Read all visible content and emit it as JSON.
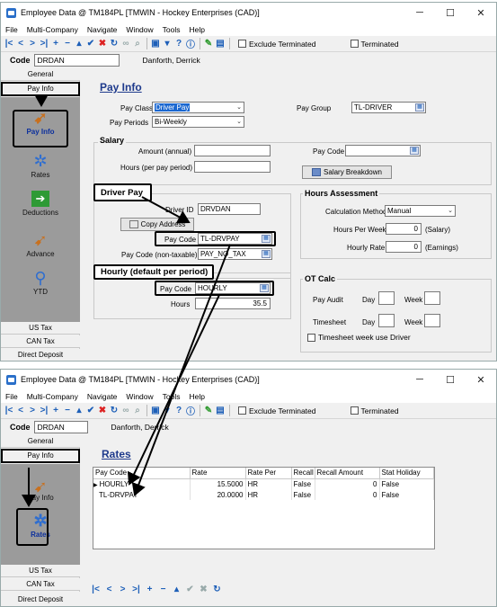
{
  "window": {
    "title": "Employee Data @ TM184PL [TMWIN - Hockey Enterprises (CAD)]",
    "controls": [
      "─",
      "☐",
      "✕"
    ]
  },
  "menu": [
    "File",
    "Multi-Company",
    "Navigate",
    "Window",
    "Tools",
    "Help"
  ],
  "toolbar": {
    "exclude_terminated": "Exclude Terminated",
    "terminated": "Terminated"
  },
  "code_bar": {
    "label": "Code",
    "value": "DRDAN",
    "name": "Danforth, Derrick"
  },
  "sidebar": {
    "tabs": [
      "General",
      "Pay Info"
    ],
    "bottom_tabs": [
      "US Tax",
      "CAN Tax",
      "Direct Deposit"
    ],
    "icons": [
      "Pay Info",
      "Rates",
      "Deductions",
      "Advance",
      "YTD"
    ]
  },
  "pay_info": {
    "title": "Pay Info",
    "pay_class_label": "Pay Class",
    "pay_class_value": "Driver Pay",
    "pay_periods_label": "Pay Periods",
    "pay_periods_value": "Bi-Weekly",
    "pay_group_label": "Pay Group",
    "pay_group_value": "TL-DRIVER",
    "salary": {
      "title": "Salary",
      "amount_label": "Amount  (annual)",
      "hours_label": "Hours (per pay period)",
      "pay_code_label": "Pay Code",
      "breakdown_button": "Salary Breakdown"
    },
    "driver_pay": {
      "title": "Driver Pay",
      "driver_id_label": "Driver ID",
      "driver_id_value": "DRVDAN",
      "copy_address": "Copy Address",
      "pay_code_label": "Pay Code",
      "pay_code_value": "TL-DRVPAY",
      "pay_code_nt_label": "Pay Code (non-taxable)",
      "pay_code_nt_value": "PAY_NO_TAX"
    },
    "hourly": {
      "title": "Hourly (default per period)",
      "pay_code_label": "Pay Code",
      "pay_code_value": "HOURLY",
      "hours_label": "Hours",
      "hours_value": "35.5"
    },
    "hours_assessment": {
      "title": "Hours Assessment",
      "calc_method_label": "Calculation Method",
      "calc_method_value": "Manual",
      "hours_per_week_label": "Hours Per Week",
      "hours_per_week_value": "0",
      "hours_per_week_unit": "(Salary)",
      "hourly_rate_label": "Hourly Rate",
      "hourly_rate_value": "0",
      "hourly_rate_unit": "(Earnings)"
    },
    "ot_calc": {
      "title": "OT Calc",
      "pay_audit_label": "Pay Audit",
      "timesheet_label": "Timesheet",
      "day_label": "Day",
      "week_label": "Week",
      "use_driver_label": "Timesheet week use Driver"
    }
  },
  "rates": {
    "title": "Rates",
    "columns": [
      "Pay Code",
      "Rate",
      "Rate Per",
      "Recall",
      "Recall Amount",
      "Stat Holiday"
    ],
    "rows": [
      [
        "HOURLY",
        "15.5000",
        "HR",
        "False",
        "0",
        "False"
      ],
      [
        "TL-DRVPAY",
        "20.0000",
        "HR",
        "False",
        "0",
        "False"
      ]
    ]
  }
}
